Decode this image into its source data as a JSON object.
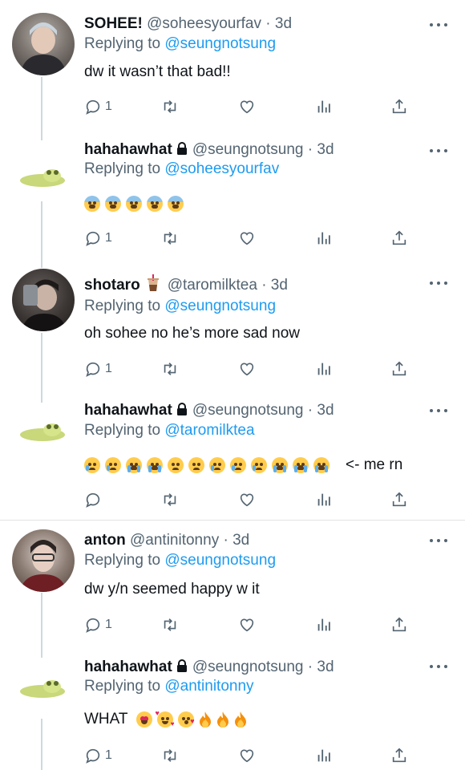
{
  "tweets": [
    {
      "name": "SOHEE!",
      "handle": "@soheesyourfav",
      "time": "· 3d",
      "replying_prefix": "Replying to",
      "replying_to": "@seungnotsung",
      "text": "dw it wasn’t that bad!!",
      "reply_count": "1"
    },
    {
      "name": "hahahawhat",
      "handle": "@seungnotsung",
      "time": "· 3d",
      "replying_prefix": "Replying to",
      "replying_to": "@soheesyourfav",
      "text": "",
      "emojis": [
        "fearful-face",
        "fearful-face",
        "fearful-face",
        "fearful-face",
        "fearful-face"
      ],
      "reply_count": "1"
    },
    {
      "name": "shotaro",
      "name_icon": "bubble-tea-icon",
      "handle": "@taromilktea",
      "time": "· 3d",
      "replying_prefix": "Replying to",
      "replying_to": "@seungnotsung",
      "text": "oh sohee no he’s more sad now",
      "reply_count": "1"
    },
    {
      "name": "hahahawhat",
      "handle": "@seungnotsung",
      "time": "· 3d",
      "replying_prefix": "Replying to",
      "replying_to": "@taromilktea",
      "text": "<- me rn",
      "emojis": [
        "crying-face",
        "crying-face",
        "loudly-crying-face",
        "loudly-crying-face",
        "sad-face",
        "sad-face",
        "pleading-face",
        "pleading-face",
        "pleading-face",
        "loudly-crying-face",
        "loudly-crying-face",
        "loudly-crying-face"
      ],
      "reply_count": ""
    },
    {
      "name": "anton",
      "handle": "@antinitonny",
      "time": "· 3d",
      "replying_prefix": "Replying to",
      "replying_to": "@seungnotsung",
      "text": "dw y/n seemed happy w it",
      "reply_count": "1"
    },
    {
      "name": "hahahawhat",
      "handle": "@seungnotsung",
      "time": "· 3d",
      "replying_prefix": "Replying to",
      "replying_to": "@antinitonny",
      "text": "WHAT",
      "emojis": [
        "heart-eyes-face",
        "smiling-face-with-hearts",
        "face-blowing-kiss",
        "fire",
        "fire",
        "fire"
      ],
      "reply_count": "1"
    }
  ],
  "icons": {
    "reply": "reply-icon",
    "retweet": "retweet-icon",
    "like": "heart-icon",
    "analytics": "analytics-icon",
    "share": "share-icon",
    "lock": "lock-icon",
    "more": "more-icon"
  },
  "colors": {
    "link": "#1d9bf0",
    "secondary": "#536471",
    "text": "#0f1419"
  }
}
